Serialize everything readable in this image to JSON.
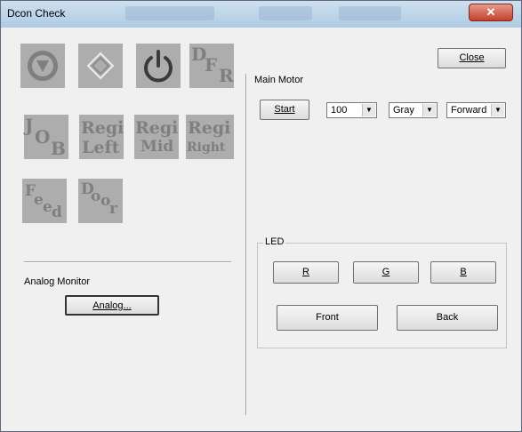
{
  "window": {
    "title": "Dcon Check",
    "close_glyph": "✕"
  },
  "status_icons": [
    {
      "name": "stop-icon"
    },
    {
      "name": "diamond-icon"
    },
    {
      "name": "power-icon"
    },
    {
      "name": "dfr-icon",
      "text": [
        "D",
        "F",
        "R"
      ]
    }
  ],
  "sensor_icons": {
    "job": [
      "J",
      "O",
      "B"
    ],
    "regi_left": [
      "Regi",
      "Left"
    ],
    "regi_mid": [
      "Regi",
      "Mid"
    ],
    "regi_right": [
      "Regi",
      "Right"
    ],
    "feed": [
      "F",
      "e",
      "e",
      "d"
    ],
    "door": [
      "D",
      "o",
      "o",
      "r"
    ]
  },
  "main_motor": {
    "label": "Main Motor",
    "start_label": "Start",
    "speed_value": "100",
    "color_value": "Gray",
    "direction_value": "Forward"
  },
  "close_button": {
    "label": "Close"
  },
  "analog_monitor": {
    "label": "Analog Monitor",
    "button_label": "Analog..."
  },
  "led": {
    "group_label": "LED",
    "r_label": "R",
    "g_label": "G",
    "b_label": "B",
    "front_label": "Front",
    "back_label": "Back"
  },
  "colors": {
    "icon_bg": "#adadad",
    "icon_fg": "#7f7f7f",
    "window_bg": "#f0f0f0"
  }
}
